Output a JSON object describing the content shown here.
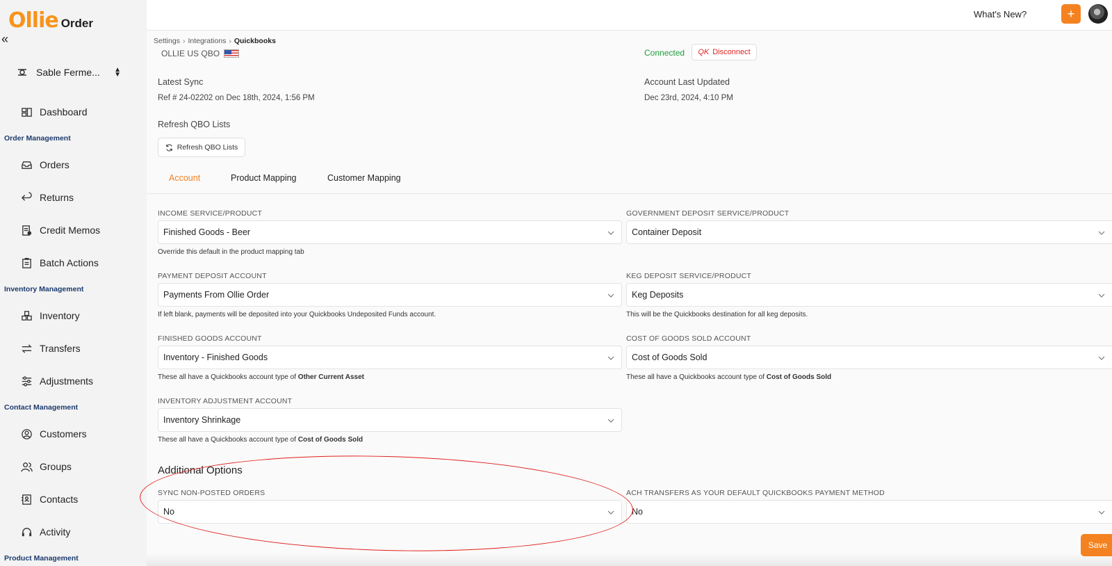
{
  "brand": {
    "name_primary": "Ollie",
    "name_secondary": "Order",
    "primary_color": "#f58220"
  },
  "sidebar": {
    "org_name": "Sable Ferme...",
    "dashboard": "Dashboard",
    "sections": {
      "order_management": "Order Management",
      "inventory_management": "Inventory Management",
      "contact_management": "Contact Management",
      "product_management": "Product Management"
    },
    "items": {
      "orders": "Orders",
      "returns": "Returns",
      "credit_memos": "Credit Memos",
      "batch_actions": "Batch Actions",
      "inventory": "Inventory",
      "transfers": "Transfers",
      "adjustments": "Adjustments",
      "customers": "Customers",
      "groups": "Groups",
      "contacts": "Contacts",
      "activity": "Activity"
    }
  },
  "topbar": {
    "whats_new": "What's New?",
    "plus": "+"
  },
  "breadcrumb": [
    "Settings",
    "Integrations",
    "Quickbooks"
  ],
  "connection": {
    "company": "OLLIE US QBO",
    "status": "Connected",
    "disconnect_label": "Disconnect",
    "disconnect_mark": "QK"
  },
  "sync": {
    "latest_label": "Latest Sync",
    "latest_value": "Ref # 24-02202 on Dec 18th, 2024, 1:56 PM",
    "account_updated_label": "Account Last Updated",
    "account_updated_value": "Dec 23rd, 2024, 4:10 PM",
    "refresh_label": "Refresh QBO Lists",
    "refresh_button": "Refresh QBO Lists"
  },
  "tabs": [
    "Account",
    "Product Mapping",
    "Customer Mapping"
  ],
  "fields": {
    "income": {
      "label": "INCOME SERVICE/PRODUCT",
      "value": "Finished Goods - Beer",
      "hint": "Override this default in the product mapping tab"
    },
    "gov_deposit": {
      "label": "GOVERNMENT DEPOSIT SERVICE/PRODUCT",
      "value": "Container Deposit"
    },
    "payment_deposit": {
      "label": "PAYMENT DEPOSIT ACCOUNT",
      "value": "Payments From Ollie Order",
      "hint": "If left blank, payments will be deposited into your Quickbooks Undeposited Funds account."
    },
    "keg_deposit": {
      "label": "KEG DEPOSIT SERVICE/PRODUCT",
      "value": "Keg Deposits",
      "hint": "This will be the Quickbooks destination for all keg deposits."
    },
    "finished_goods": {
      "label": "FINISHED GOODS ACCOUNT",
      "value": "Inventory - Finished Goods",
      "hint_prefix": "These all have a Quickbooks account type of ",
      "hint_bold": "Other Current Asset"
    },
    "cogs": {
      "label": "COST OF GOODS SOLD ACCOUNT",
      "value": "Cost of Goods Sold",
      "hint_prefix": "These all have a Quickbooks account type of ",
      "hint_bold": "Cost of Goods Sold"
    },
    "inventory_adjustment": {
      "label": "INVENTORY ADJUSTMENT ACCOUNT",
      "value": "Inventory Shrinkage",
      "hint_prefix": "These all have a Quickbooks account type of ",
      "hint_bold": "Cost of Goods Sold"
    }
  },
  "additional": {
    "title": "Additional Options",
    "sync_non_posted": {
      "label": "SYNC NON-POSTED ORDERS",
      "value": "No"
    },
    "ach_default": {
      "label": "ACH TRANSFERS AS YOUR DEFAULT QUICKBOOKS PAYMENT METHOD",
      "value": "No"
    }
  },
  "save": "Save"
}
